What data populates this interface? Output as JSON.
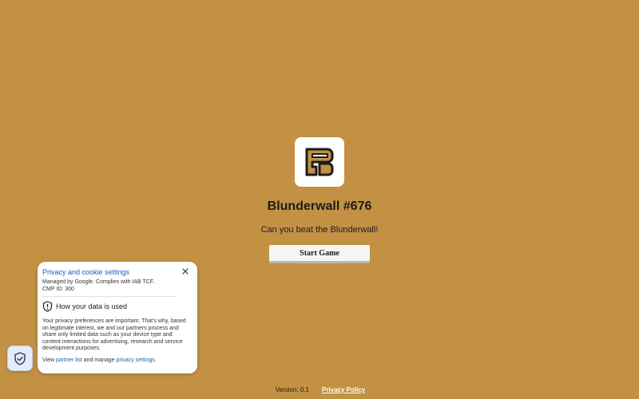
{
  "game": {
    "logo_icon": "blunderwall-logo-icon",
    "title": "Blunderwall #676",
    "subtitle": "Can you beat the Blunderwall!",
    "start_label": "Start Game"
  },
  "footer": {
    "version": "Version: 0.1",
    "privacy_policy": "Privacy Policy"
  },
  "privacy": {
    "title": "Privacy and cookie settings",
    "managed_line1": "Managed by Google. Complies with IAB TCF.",
    "managed_line2": "CMP ID: 300",
    "heading": "How your data is used",
    "body": "Your privacy preferences are important. That's why, based on legitimate interest, we and our partners process and share only limited data such as your device type and content interactions for advertising, research and service development purposes.",
    "links_prefix": "View ",
    "partner_list": "partner list",
    "links_middle": " and manage ",
    "privacy_settings": "privacy settings",
    "links_suffix": "."
  },
  "colors": {
    "background": "#c29143",
    "link_blue": "#1a5fb4",
    "fab_bg": "#e3ecfa"
  }
}
